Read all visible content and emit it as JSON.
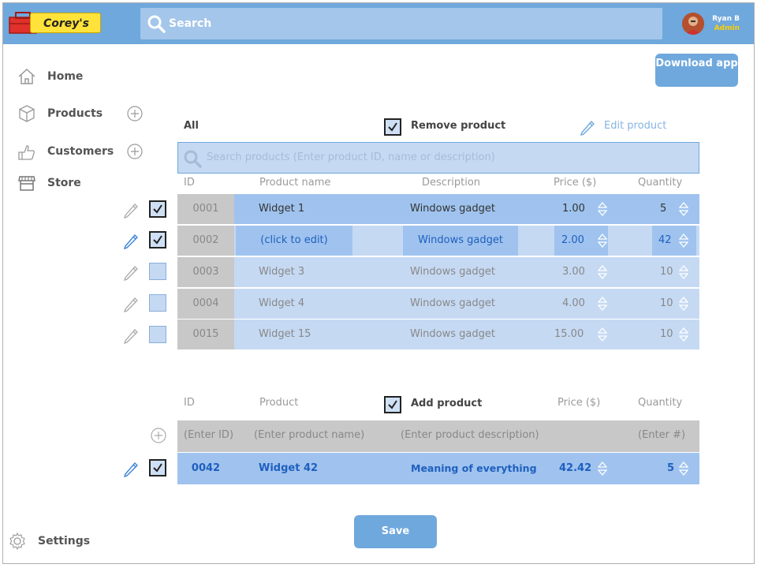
{
  "app": {
    "brand": "Corey's",
    "search_placeholder": "Search"
  },
  "user": {
    "name": "Ryan B",
    "role": "Admin"
  },
  "nav": [
    {
      "label": "Home",
      "icon": "home-icon"
    },
    {
      "label": "Products",
      "icon": "box-icon"
    },
    {
      "label": "Customers",
      "icon": "customer-icon"
    },
    {
      "label": "Store",
      "icon": "store-icon"
    }
  ],
  "settings_label": "Settings",
  "download_label": "Download app",
  "products": {
    "filter_label": "All",
    "remove_label": "Remove product",
    "edit_label": "Edit product",
    "search_placeholder": "Search products (Enter product ID, name or description)",
    "columns": {
      "id": "ID",
      "name": "Product name",
      "desc": "Description",
      "price": "Price ($)",
      "qty": "Quantity"
    },
    "rows": [
      {
        "id": "0001",
        "name": "Widget 1",
        "desc": "Windows gadget",
        "price": "1.00",
        "qty": "5",
        "checked": true
      },
      {
        "id": "0002",
        "name": "(click to edit)",
        "desc": "Windows gadget",
        "price": "2.00",
        "qty": "42",
        "checked": true
      },
      {
        "id": "0003",
        "name": "Widget 3",
        "desc": "Windows gadget",
        "price": "3.00",
        "qty": "10",
        "checked": false
      },
      {
        "id": "0004",
        "name": "Widget 4",
        "desc": "Windows gadget",
        "price": "4.00",
        "qty": "10",
        "checked": false
      },
      {
        "id": "0015",
        "name": "Widget 15",
        "desc": "Windows gadget",
        "price": "15.00",
        "qty": "10",
        "checked": false
      }
    ]
  },
  "add": {
    "columns": {
      "id": "ID",
      "product": "Product",
      "price": "Price ($)",
      "qty": "Quantity"
    },
    "add_label": "Add product",
    "placeholders": {
      "id": "(Enter ID)",
      "name": "(Enter product name)",
      "desc": "(Enter product description)",
      "qty": "(Enter #)"
    },
    "row": {
      "id": "0042",
      "name": "Widget 42",
      "desc": "Meaning of everything",
      "price": "42.42",
      "qty": "5"
    }
  },
  "save_label": "Save",
  "colors": {
    "topbar": "#6fa8dc",
    "row_selected": "#9fc3ee",
    "row_normal": "#c5d9f3",
    "accent_blue": "#1f5fbf"
  }
}
